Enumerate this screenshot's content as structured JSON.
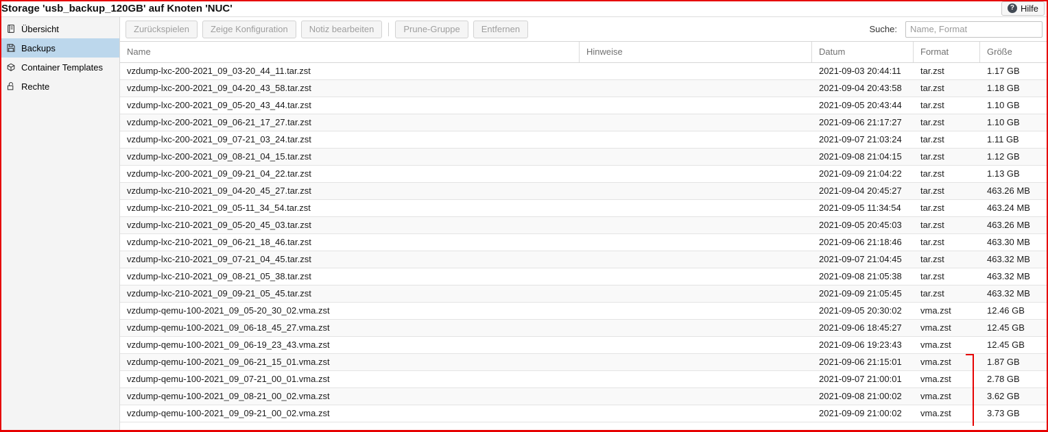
{
  "window": {
    "title": "Storage 'usb_backup_120GB' auf Knoten 'NUC'",
    "help_label": "Hilfe",
    "help_icon": "question-circle-icon"
  },
  "sidebar": {
    "items": [
      {
        "label": "Übersicht",
        "icon": "overview-icon",
        "selected": false
      },
      {
        "label": "Backups",
        "icon": "backups-icon",
        "selected": true
      },
      {
        "label": "Container Templates",
        "icon": "container-templates-icon",
        "selected": false
      },
      {
        "label": "Rechte",
        "icon": "permissions-icon",
        "selected": false
      }
    ]
  },
  "toolbar": {
    "items": [
      {
        "type": "button",
        "label": "Zurückspielen",
        "disabled": true
      },
      {
        "type": "button",
        "label": "Zeige Konfiguration",
        "disabled": true
      },
      {
        "type": "button",
        "label": "Notiz bearbeiten",
        "disabled": true
      },
      {
        "type": "separator"
      },
      {
        "type": "button",
        "label": "Prune-Gruppe",
        "disabled": true
      },
      {
        "type": "button",
        "label": "Entfernen",
        "disabled": true
      }
    ],
    "search_label": "Suche:",
    "search_placeholder": "Name, Format",
    "search_value": ""
  },
  "grid": {
    "columns": [
      "Name",
      "Hinweise",
      "Datum",
      "Format",
      "Größe"
    ],
    "rows": [
      [
        "vzdump-lxc-200-2021_09_03-20_44_11.tar.zst",
        "",
        "2021-09-03 20:44:11",
        "tar.zst",
        "1.17 GB"
      ],
      [
        "vzdump-lxc-200-2021_09_04-20_43_58.tar.zst",
        "",
        "2021-09-04 20:43:58",
        "tar.zst",
        "1.18 GB"
      ],
      [
        "vzdump-lxc-200-2021_09_05-20_43_44.tar.zst",
        "",
        "2021-09-05 20:43:44",
        "tar.zst",
        "1.10 GB"
      ],
      [
        "vzdump-lxc-200-2021_09_06-21_17_27.tar.zst",
        "",
        "2021-09-06 21:17:27",
        "tar.zst",
        "1.10 GB"
      ],
      [
        "vzdump-lxc-200-2021_09_07-21_03_24.tar.zst",
        "",
        "2021-09-07 21:03:24",
        "tar.zst",
        "1.11 GB"
      ],
      [
        "vzdump-lxc-200-2021_09_08-21_04_15.tar.zst",
        "",
        "2021-09-08 21:04:15",
        "tar.zst",
        "1.12 GB"
      ],
      [
        "vzdump-lxc-200-2021_09_09-21_04_22.tar.zst",
        "",
        "2021-09-09 21:04:22",
        "tar.zst",
        "1.13 GB"
      ],
      [
        "vzdump-lxc-210-2021_09_04-20_45_27.tar.zst",
        "",
        "2021-09-04 20:45:27",
        "tar.zst",
        "463.26 MB"
      ],
      [
        "vzdump-lxc-210-2021_09_05-11_34_54.tar.zst",
        "",
        "2021-09-05 11:34:54",
        "tar.zst",
        "463.24 MB"
      ],
      [
        "vzdump-lxc-210-2021_09_05-20_45_03.tar.zst",
        "",
        "2021-09-05 20:45:03",
        "tar.zst",
        "463.26 MB"
      ],
      [
        "vzdump-lxc-210-2021_09_06-21_18_46.tar.zst",
        "",
        "2021-09-06 21:18:46",
        "tar.zst",
        "463.30 MB"
      ],
      [
        "vzdump-lxc-210-2021_09_07-21_04_45.tar.zst",
        "",
        "2021-09-07 21:04:45",
        "tar.zst",
        "463.32 MB"
      ],
      [
        "vzdump-lxc-210-2021_09_08-21_05_38.tar.zst",
        "",
        "2021-09-08 21:05:38",
        "tar.zst",
        "463.32 MB"
      ],
      [
        "vzdump-lxc-210-2021_09_09-21_05_45.tar.zst",
        "",
        "2021-09-09 21:05:45",
        "tar.zst",
        "463.32 MB"
      ],
      [
        "vzdump-qemu-100-2021_09_05-20_30_02.vma.zst",
        "",
        "2021-09-05 20:30:02",
        "vma.zst",
        "12.46 GB"
      ],
      [
        "vzdump-qemu-100-2021_09_06-18_45_27.vma.zst",
        "",
        "2021-09-06 18:45:27",
        "vma.zst",
        "12.45 GB"
      ],
      [
        "vzdump-qemu-100-2021_09_06-19_23_43.vma.zst",
        "",
        "2021-09-06 19:23:43",
        "vma.zst",
        "12.45 GB"
      ],
      [
        "vzdump-qemu-100-2021_09_06-21_15_01.vma.zst",
        "",
        "2021-09-06 21:15:01",
        "vma.zst",
        "1.87 GB"
      ],
      [
        "vzdump-qemu-100-2021_09_07-21_00_01.vma.zst",
        "",
        "2021-09-07 21:00:01",
        "vma.zst",
        "2.78 GB"
      ],
      [
        "vzdump-qemu-100-2021_09_08-21_00_02.vma.zst",
        "",
        "2021-09-08 21:00:02",
        "vma.zst",
        "3.62 GB"
      ],
      [
        "vzdump-qemu-100-2021_09_09-21_00_02.vma.zst",
        "",
        "2021-09-09 21:00:02",
        "vma.zst",
        "3.73 GB"
      ]
    ]
  },
  "annotations": {
    "frame_color": "#e60000",
    "bracket_color": "#e60000",
    "bracket_marks_rows": "last four vma.zst backups"
  },
  "colors": {
    "sidebar_selection": "#bcd7ec",
    "sidebar_background": "#f4f4f4",
    "row_stripe": "#f9f9f9"
  }
}
